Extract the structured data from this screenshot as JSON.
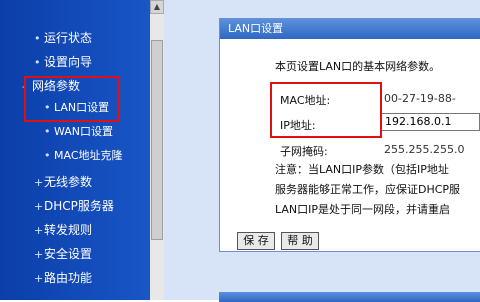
{
  "sidebar": {
    "items": [
      {
        "label": "运行状态"
      },
      {
        "label": "设置向导"
      },
      {
        "label": "网络参数"
      },
      {
        "label": "LAN口设置"
      },
      {
        "label": "WAN口设置"
      },
      {
        "label": "MAC地址克隆"
      },
      {
        "label": "无线参数"
      },
      {
        "label": "DHCP服务器"
      },
      {
        "label": "转发规则"
      },
      {
        "label": "安全设置"
      },
      {
        "label": "路由功能"
      }
    ]
  },
  "panel": {
    "title": "LAN口设置",
    "intro": "本页设置LAN口的基本网络参数。",
    "mac_label": "MAC地址:",
    "mac_value": "00-27-19-88-",
    "ip_label": "IP地址:",
    "ip_value": "192.168.0.1",
    "mask_label": "子网掩码:",
    "mask_value": "255.255.255.0",
    "note_lines": [
      "注意：当LAN口IP参数（包括IP地址",
      "服务器能够正常工作，应保证DHCP服",
      "LAN口IP是处于同一网段，并请重启"
    ],
    "save_label": "保 存",
    "help_label": "帮 助"
  },
  "colors": {
    "nav_bg": "#0b3ea8",
    "title_bar": "#2e67c4",
    "highlight": "#e01010"
  }
}
